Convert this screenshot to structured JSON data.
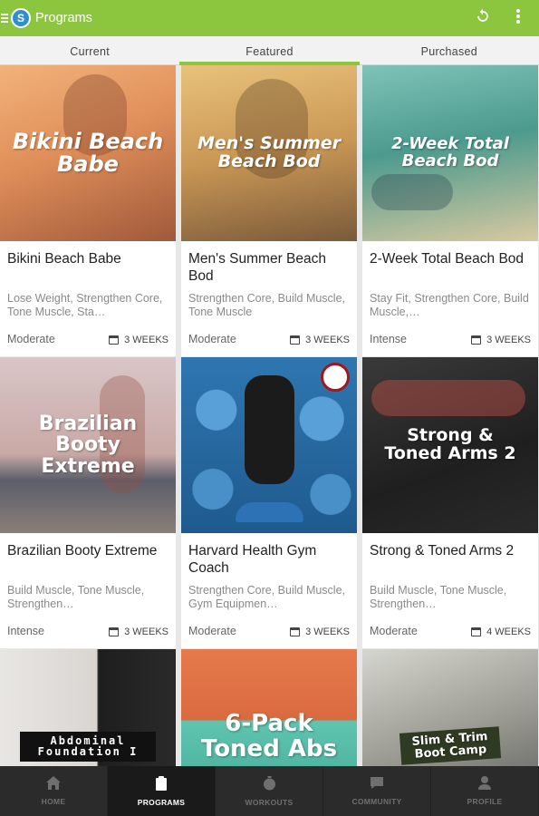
{
  "appbar": {
    "title": "Programs",
    "logo_letter": "S"
  },
  "tabs": [
    {
      "label": "Current"
    },
    {
      "label": "Featured"
    },
    {
      "label": "Purchased"
    }
  ],
  "cards": [
    {
      "image_title": "Bikini Beach Babe",
      "title": "Bikini Beach Babe",
      "tags": "Lose Weight, Strengthen Core, Tone Muscle, Sta…",
      "level": "Moderate",
      "weeks": "3 WEEKS"
    },
    {
      "image_title": "Men's Summer Beach Bod",
      "title": "Men's Summer Beach Bod",
      "tags": "Strengthen Core, Build Muscle, Tone Muscle",
      "level": "Moderate",
      "weeks": "3 WEEKS"
    },
    {
      "image_title": "2-Week Total Beach Bod",
      "title": "2-Week Total Beach Bod",
      "tags": "Stay Fit, Strengthen Core, Build Muscle,…",
      "level": "Intense",
      "weeks": "3 WEEKS"
    },
    {
      "image_title": "Brazilian Booty Extreme",
      "title": "Brazilian Booty Extreme",
      "tags": "Build Muscle, Tone Muscle, Strengthen…",
      "level": "Intense",
      "weeks": "3 WEEKS"
    },
    {
      "image_title": "",
      "title": "Harvard Health Gym Coach",
      "tags": "Strengthen Core, Build Muscle, Gym Equipmen…",
      "level": "Moderate",
      "weeks": "3 WEEKS"
    },
    {
      "image_title": "Strong & Toned Arms 2",
      "title": "Strong & Toned Arms 2",
      "tags": "Build Muscle, Tone Muscle, Strengthen…",
      "level": "Moderate",
      "weeks": "4 WEEKS"
    },
    {
      "image_title": "Abdominal Foundation I",
      "title": "",
      "tags": "",
      "level": "",
      "weeks": ""
    },
    {
      "image_title": "6-Pack Toned Abs",
      "title": "",
      "tags": "",
      "level": "",
      "weeks": ""
    },
    {
      "image_title": "Slim & Trim Boot Camp",
      "title": "",
      "tags": "",
      "level": "",
      "weeks": ""
    }
  ],
  "bottom_nav": [
    {
      "label": "HOME",
      "icon": "home-icon"
    },
    {
      "label": "PROGRAMS",
      "icon": "clipboard-icon"
    },
    {
      "label": "WORKOUTS",
      "icon": "stopwatch-icon"
    },
    {
      "label": "COMMUNITY",
      "icon": "chat-icon"
    },
    {
      "label": "PROFILE",
      "icon": "person-icon"
    }
  ],
  "colors": {
    "accent": "#8cc63e",
    "nav_bg": "#2b2b2b"
  }
}
